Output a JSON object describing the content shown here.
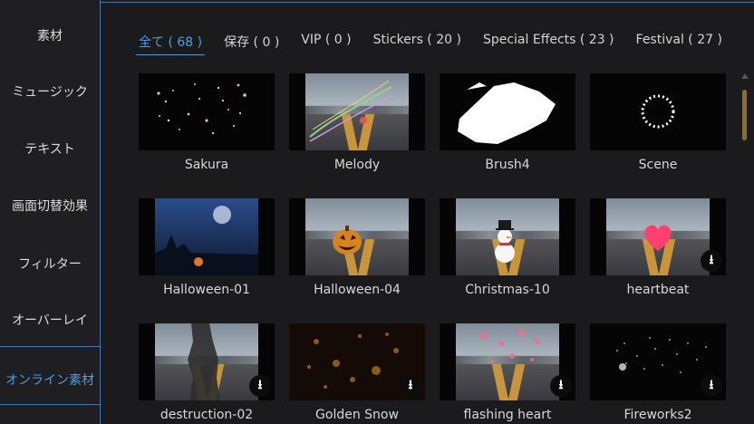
{
  "sidebar": {
    "items": [
      {
        "label": "素材"
      },
      {
        "label": "ミュージック"
      },
      {
        "label": "テキスト"
      },
      {
        "label": "画面切替効果"
      },
      {
        "label": "フィルター"
      },
      {
        "label": "オーバーレイ"
      },
      {
        "label": "オンライン素材"
      }
    ],
    "active_index": 6
  },
  "tabs": [
    {
      "label": "全て ( 68 )"
    },
    {
      "label": "保存 ( 0 )"
    },
    {
      "label": "VIP ( 0 )"
    },
    {
      "label": "Stickers ( 20 )"
    },
    {
      "label": "Special Effects ( 23 )"
    },
    {
      "label": "Festival ( 27 )"
    }
  ],
  "active_tab_index": 0,
  "items": [
    {
      "label": "Sakura",
      "download": false
    },
    {
      "label": "Melody",
      "download": false
    },
    {
      "label": "Brush4",
      "download": false
    },
    {
      "label": "Scene",
      "download": false
    },
    {
      "label": "Halloween-01",
      "download": false
    },
    {
      "label": "Halloween-04",
      "download": false
    },
    {
      "label": "Christmas-10",
      "download": false
    },
    {
      "label": "heartbeat",
      "download": true
    },
    {
      "label": "destruction-02",
      "download": true
    },
    {
      "label": "Golden Snow",
      "download": true
    },
    {
      "label": "flashing heart",
      "download": true
    },
    {
      "label": "Fireworks2",
      "download": true
    }
  ],
  "icons": {
    "download": "download-icon",
    "scroll_up": "scroll-up-arrow-icon"
  },
  "colors": {
    "accent": "#4a9fe8",
    "border": "#3b78b5",
    "scroll_thumb": "#8a6f2a",
    "background": "#1b1b1d"
  }
}
